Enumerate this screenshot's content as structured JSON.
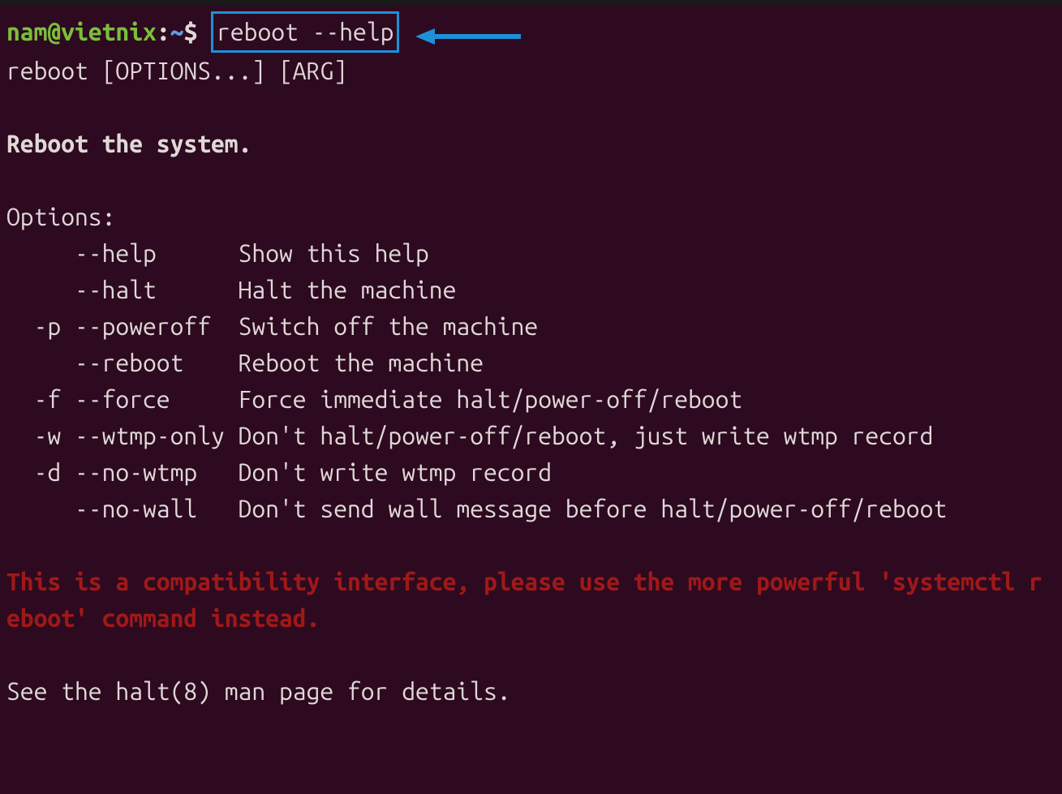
{
  "prompt": {
    "user": "nam@vietnix",
    "colon": ":",
    "path": "~",
    "dollar": "$"
  },
  "command": "reboot --help",
  "output": {
    "usage": "reboot [OPTIONS...] [ARG]",
    "heading": "Reboot the system.",
    "options_header": "Options:",
    "options": [
      {
        "flag": "     --help      ",
        "desc": "Show this help"
      },
      {
        "flag": "     --halt      ",
        "desc": "Halt the machine"
      },
      {
        "flag": "  -p --poweroff  ",
        "desc": "Switch off the machine"
      },
      {
        "flag": "     --reboot    ",
        "desc": "Reboot the machine"
      },
      {
        "flag": "  -f --force     ",
        "desc": "Force immediate halt/power-off/reboot"
      },
      {
        "flag": "  -w --wtmp-only ",
        "desc": "Don't halt/power-off/reboot, just write wtmp record"
      },
      {
        "flag": "  -d --no-wtmp   ",
        "desc": "Don't write wtmp record"
      },
      {
        "flag": "     --no-wall   ",
        "desc": "Don't send wall message before halt/power-off/reboot"
      }
    ],
    "warning": "This is a compatibility interface, please use the more powerful 'systemctl reboot' command instead.",
    "footer": "See the halt(8) man page for details."
  }
}
